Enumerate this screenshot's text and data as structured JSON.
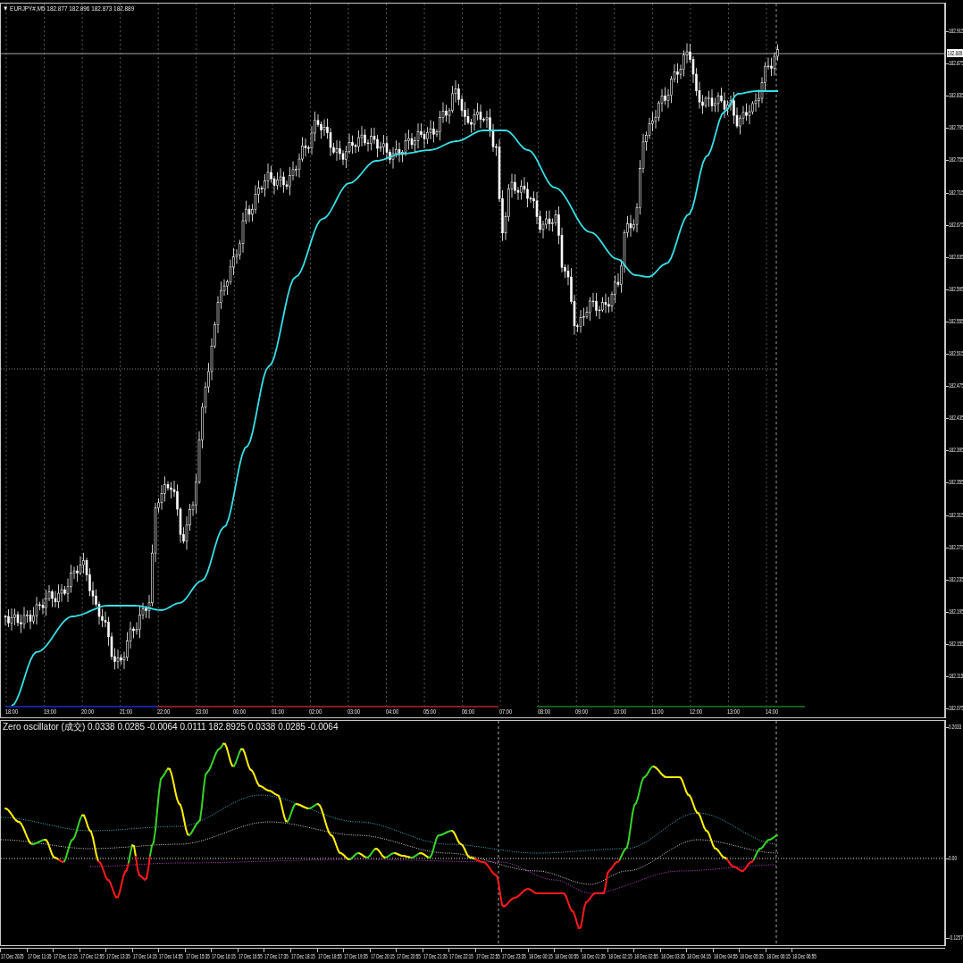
{
  "chart": {
    "title": "▼ EURJPY#,M5 182.877 182.896 182.873 182.889",
    "price_ticks": [
      "182.915",
      "182.875",
      "182.835",
      "182.795",
      "182.755",
      "182.715",
      "182.675",
      "182.635",
      "182.595",
      "182.555",
      "182.515",
      "182.475",
      "182.435",
      "182.395",
      "182.355",
      "182.315",
      "182.275",
      "182.235",
      "182.195",
      "182.155",
      "182.115",
      "182.075"
    ],
    "current_price": "182.889",
    "time_labels": [
      "18:00",
      "19:00",
      "20:00",
      "21:00",
      "22:00",
      "23:00",
      "00:00",
      "01:00",
      "02:00",
      "03:00",
      "04:00",
      "05:00",
      "06:00",
      "07:00",
      "08:00",
      "09:00",
      "10:00",
      "11:00",
      "12:00",
      "13:00",
      "14:00"
    ]
  },
  "indicator": {
    "title": "Zero oscillator (成交) 0.0338 0.0285 -0.0064 0.0111 182.8925 0.0338 0.0285 -0.0064",
    "ticks": [
      "0.2033",
      "0.00",
      "-0.1257"
    ]
  },
  "date_labels": [
    "17 Dec 2025",
    "17 Dec 11:35",
    "17 Dec 12:15",
    "17 Dec 12:55",
    "17 Dec 13:35",
    "17 Dec 14:15",
    "17 Dec 14:55",
    "17 Dec 15:35",
    "17 Dec 16:15",
    "17 Dec 16:55",
    "17 Dec 17:35",
    "17 Dec 18:15",
    "17 Dec 18:55",
    "17 Dec 19:35",
    "17 Dec 20:15",
    "17 Dec 20:55",
    "17 Dec 21:35",
    "17 Dec 22:15",
    "17 Dec 22:55",
    "17 Dec 23:35",
    "18 Dec 00:15",
    "18 Dec 00:55",
    "18 Dec 01:35",
    "18 Dec 02:15",
    "18 Dec 02:55",
    "18 Dec 03:35",
    "18 Dec 04:15",
    "18 Dec 04:55",
    "18 Dec 05:35",
    "18 Dec 06:15",
    "18 Dec 06:55"
  ]
}
